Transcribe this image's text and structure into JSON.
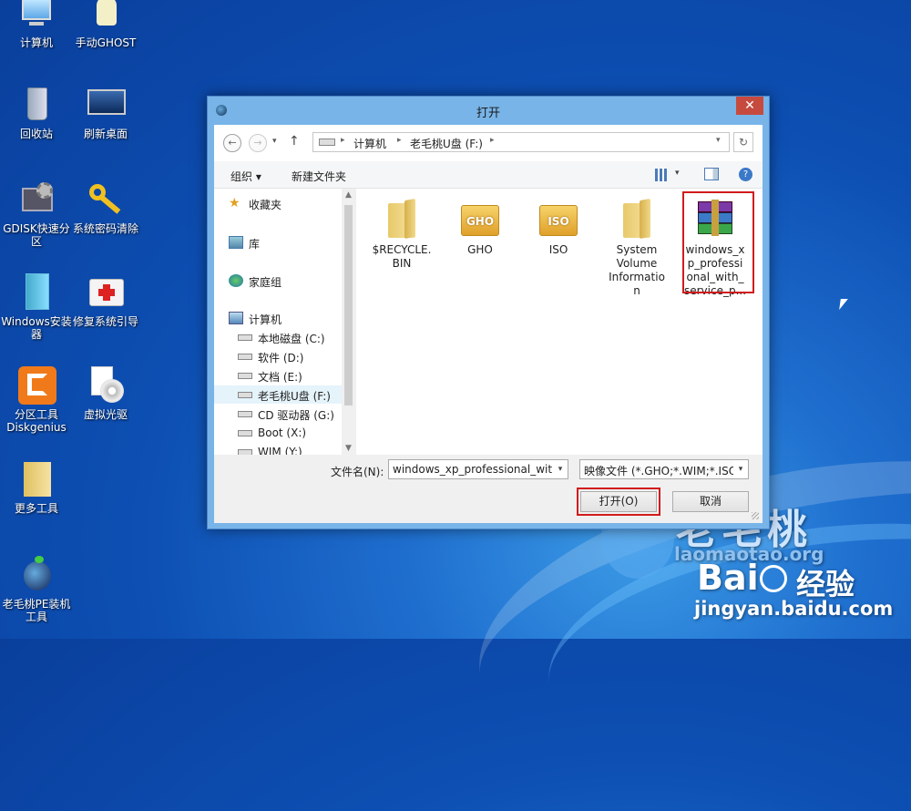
{
  "desktop": {
    "icons": [
      {
        "label": "计算机"
      },
      {
        "label": "手动GHOST"
      },
      {
        "label": "回收站"
      },
      {
        "label": "刷新桌面"
      },
      {
        "label": "GDISK快速分区"
      },
      {
        "label": "系统密码清除"
      },
      {
        "label": "Windows安装器"
      },
      {
        "label": "修复系统引导"
      },
      {
        "label": "分区工具Diskgenius"
      },
      {
        "label": "虚拟光驱"
      },
      {
        "label": "更多工具"
      },
      {
        "label": "老毛桃PE装机工具"
      }
    ]
  },
  "watermark": {
    "brand": "老毛桃",
    "site": "laomaotao.org",
    "baidu": "Bai",
    "baidu_suffix": "经验",
    "url": "jingyan.baidu.com"
  },
  "dialog": {
    "title": "打开",
    "close": "✕",
    "address": {
      "segments": [
        "计算机",
        "老毛桃U盘 (F:)"
      ],
      "separator": "▸"
    },
    "toolbar": {
      "organize": "组织 ▾",
      "new_folder": "新建文件夹"
    },
    "nav": [
      {
        "label": "收藏夹"
      },
      {
        "label": "库"
      },
      {
        "label": "家庭组"
      },
      {
        "label": "计算机"
      },
      {
        "label": "本地磁盘 (C:)"
      },
      {
        "label": "软件 (D:)"
      },
      {
        "label": "文档 (E:)"
      },
      {
        "label": "老毛桃U盘 (F:)"
      },
      {
        "label": "CD 驱动器 (G:)"
      },
      {
        "label": "Boot (X:)"
      },
      {
        "label": "WIM (Y:)"
      }
    ],
    "files": [
      {
        "name": "$RECYCLE.\nBIN",
        "type": "folder"
      },
      {
        "name": "GHO",
        "type": "disk",
        "badge": "GHO"
      },
      {
        "name": "ISO",
        "type": "disk",
        "badge": "ISO"
      },
      {
        "name": "System\nVolume\nInformatio\nn",
        "type": "folder"
      },
      {
        "name": "windows_x\np_professi\nonal_with_\nservice_p...",
        "type": "archive"
      }
    ],
    "filename_label": "文件名(N):",
    "filename_value": "windows_xp_professional_with_",
    "filter_value": "映像文件 (*.GHO;*.WIM;*.ISO",
    "open_button": "打开(O)",
    "cancel_button": "取消"
  },
  "colors": {
    "highlight": "#d11c1c",
    "close": "#c74a3f",
    "frame": "#78b4e8"
  }
}
